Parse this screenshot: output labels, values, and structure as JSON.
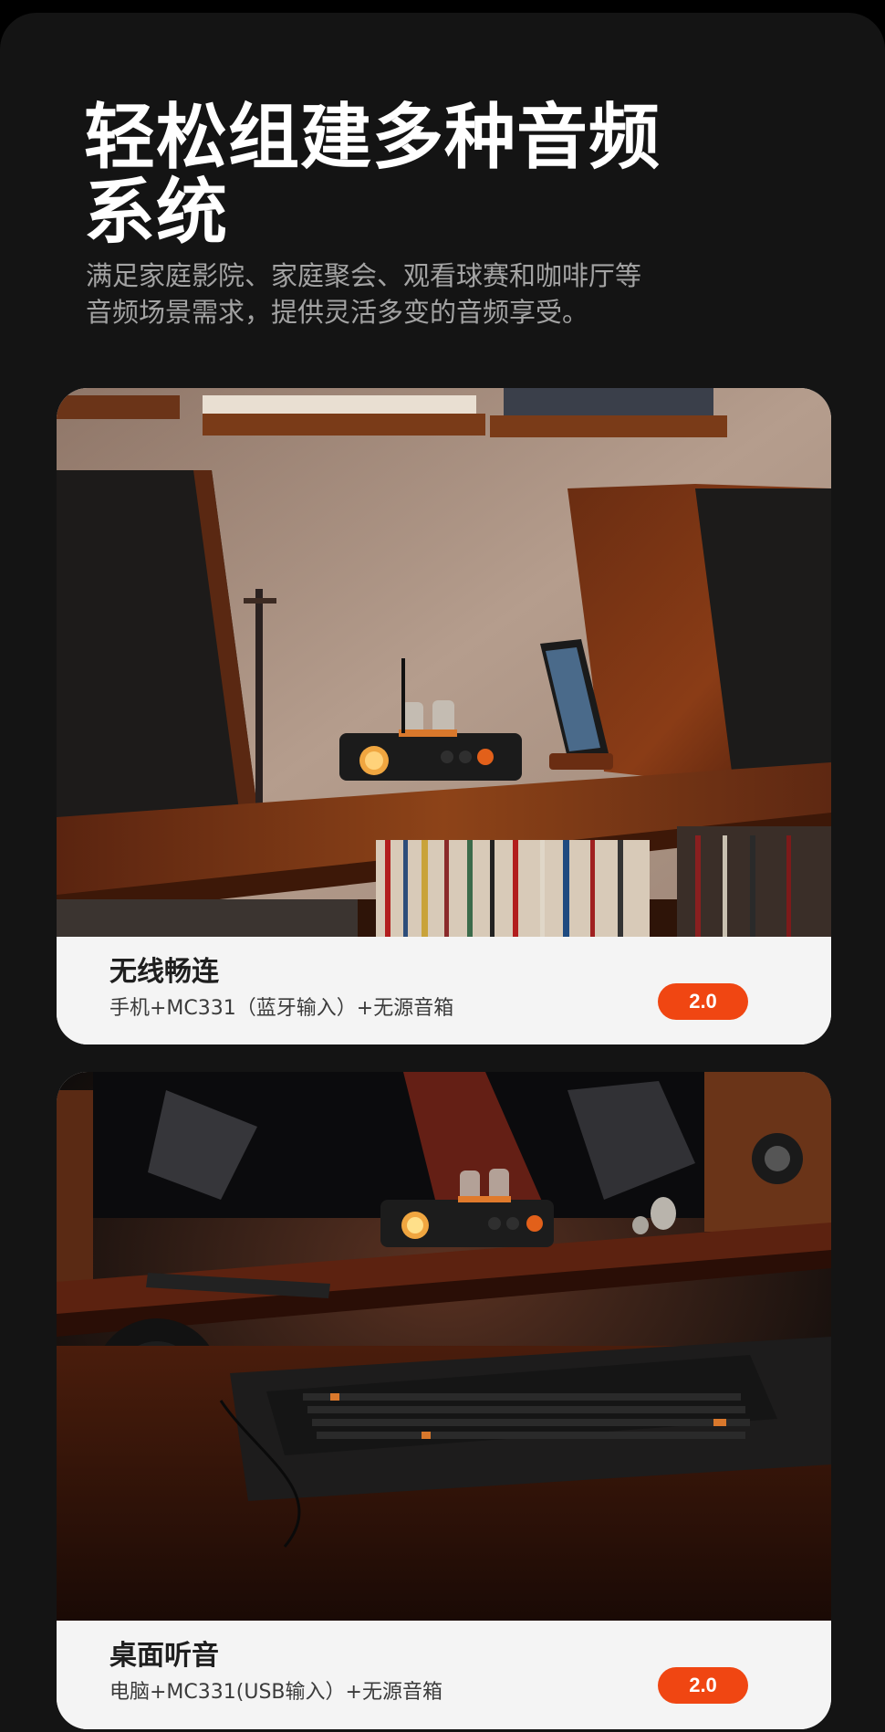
{
  "header": {
    "title": "轻松组建多种音频\n系统",
    "subtitle": "满足家庭影院、家庭聚会、观看球赛和咖啡厅等\n音频场景需求，提供灵活多变的音频享受。"
  },
  "scenarios": [
    {
      "title": "无线畅连",
      "description": "手机+MC331（蓝牙输入）+无源音箱",
      "badge": "2.0"
    },
    {
      "title": "桌面听音",
      "description": "电脑+MC331(USB输入）+无源音箱",
      "badge": "2.0"
    }
  ],
  "colors": {
    "page_background": "#141414",
    "headline": "#ffffff",
    "subtitle": "#a3a3a3",
    "card_caption_background": "#f4f4f4",
    "badge_background": "#f04612",
    "accent_wood": "#7a3a1a"
  }
}
